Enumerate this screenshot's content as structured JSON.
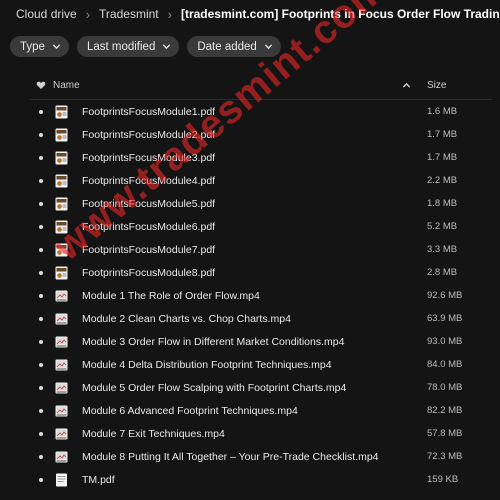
{
  "breadcrumb": {
    "items": [
      "Cloud drive",
      "Tradesmint",
      "[tradesmint.com] Footprints in Focus Order Flow Trading"
    ],
    "separator": "›"
  },
  "filters": [
    {
      "label": "Type"
    },
    {
      "label": "Last modified"
    },
    {
      "label": "Date added"
    }
  ],
  "table": {
    "col_name": "Name",
    "col_size": "Size",
    "favorite_icon": "heart-icon",
    "sort_icon": "chevron-up-icon"
  },
  "files": [
    {
      "name": "FootprintsFocusModule1.pdf",
      "size": "1.6 MB",
      "kind": "pdf"
    },
    {
      "name": "FootprintsFocusModule2.pdf",
      "size": "1.7 MB",
      "kind": "pdf"
    },
    {
      "name": "FootprintsFocusModule3.pdf",
      "size": "1.7 MB",
      "kind": "pdf"
    },
    {
      "name": "FootprintsFocusModule4.pdf",
      "size": "2.2 MB",
      "kind": "pdf"
    },
    {
      "name": "FootprintsFocusModule5.pdf",
      "size": "1.8 MB",
      "kind": "pdf"
    },
    {
      "name": "FootprintsFocusModule6.pdf",
      "size": "5.2 MB",
      "kind": "pdf"
    },
    {
      "name": "FootprintsFocusModule7.pdf",
      "size": "3.3 MB",
      "kind": "pdf"
    },
    {
      "name": "FootprintsFocusModule8.pdf",
      "size": "2.8 MB",
      "kind": "pdf"
    },
    {
      "name": "Module 1 The Role of Order Flow.mp4",
      "size": "92.6 MB",
      "kind": "video"
    },
    {
      "name": "Module 2 Clean Charts vs. Chop Charts.mp4",
      "size": "63.9 MB",
      "kind": "video"
    },
    {
      "name": "Module 3 Order Flow in Different Market Conditions.mp4",
      "size": "93.0 MB",
      "kind": "video"
    },
    {
      "name": "Module 4 Delta Distribution Footprint Techniques.mp4",
      "size": "84.0 MB",
      "kind": "video"
    },
    {
      "name": "Module 5 Order Flow Scalping with Footprint Charts.mp4",
      "size": "78.0 MB",
      "kind": "video"
    },
    {
      "name": "Module 6 Advanced Footprint Techniques.mp4",
      "size": "82.2 MB",
      "kind": "video"
    },
    {
      "name": "Module 7 Exit Techniques.mp4",
      "size": "57.8 MB",
      "kind": "video"
    },
    {
      "name": "Module 8 Putting It All Together – Your Pre-Trade Checklist.mp4",
      "size": "72.3 MB",
      "kind": "video"
    },
    {
      "name": "TM.pdf",
      "size": "159 KB",
      "kind": "doc"
    }
  ],
  "watermark": "www.tradesmint.com",
  "colors": {
    "background": "#141414",
    "chip": "#3a3a3a",
    "watermark": "#ff2828"
  }
}
